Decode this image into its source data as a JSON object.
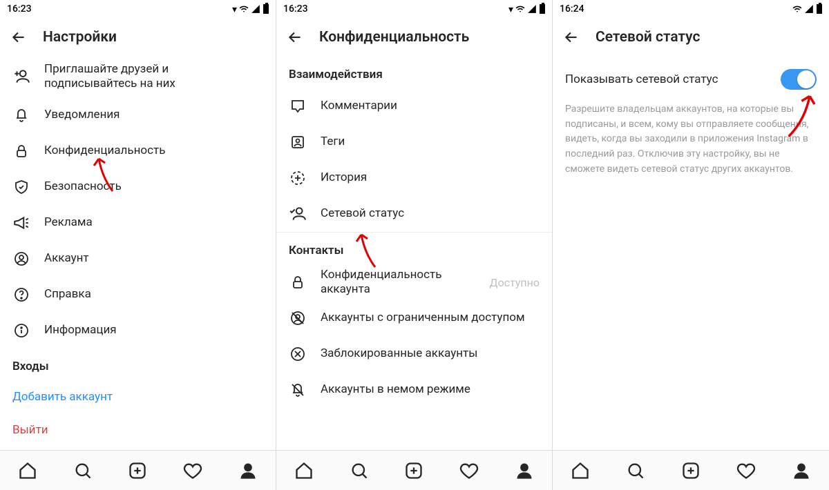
{
  "screens": [
    {
      "time": "16:23",
      "title": "Настройки",
      "rows": [
        {
          "icon": "add-user",
          "label": "Приглашайте друзей и подписывайтесь на них",
          "double": true
        },
        {
          "icon": "bell",
          "label": "Уведомления"
        },
        {
          "icon": "lock",
          "label": "Конфиденциальность"
        },
        {
          "icon": "shield",
          "label": "Безопасность"
        },
        {
          "icon": "megaphone",
          "label": "Реклама"
        },
        {
          "icon": "user",
          "label": "Аккаунт"
        },
        {
          "icon": "help",
          "label": "Справка"
        },
        {
          "icon": "info",
          "label": "Информация"
        }
      ],
      "section": "Входы",
      "links": [
        {
          "label": "Добавить аккаунт",
          "cls": "link-blue"
        },
        {
          "label": "Выйти",
          "cls": "link-red"
        }
      ]
    },
    {
      "time": "16:23",
      "title": "Конфиденциальность",
      "groups": [
        {
          "head": "Взаимодействия",
          "rows": [
            {
              "icon": "comment",
              "label": "Комментарии"
            },
            {
              "icon": "tag",
              "label": "Теги"
            },
            {
              "icon": "story",
              "label": "История"
            },
            {
              "icon": "activity",
              "label": "Сетевой статус"
            }
          ]
        },
        {
          "head": "Контакты",
          "rows": [
            {
              "icon": "lock",
              "label": "Конфиденциальность аккаунта",
              "trail": "Доступно"
            },
            {
              "icon": "restricted",
              "label": "Аккаунты с ограниченным доступом"
            },
            {
              "icon": "blocked",
              "label": "Заблокированные аккаунты"
            },
            {
              "icon": "muted",
              "label": "Аккаунты в немом режиме"
            }
          ]
        }
      ]
    },
    {
      "time": "16:24",
      "title": "Сетевой статус",
      "toggle_label": "Показывать сетевой статус",
      "toggle_on": true,
      "description": "Разрешите владельцам аккаунтов, на которые вы подписаны, и всем, кому вы отправляете сообщения, видеть, когда вы заходили в приложения Instagram в последний раз. Отключив эту настройку, вы не сможете видеть сетевой статус других аккаунтов."
    }
  ]
}
